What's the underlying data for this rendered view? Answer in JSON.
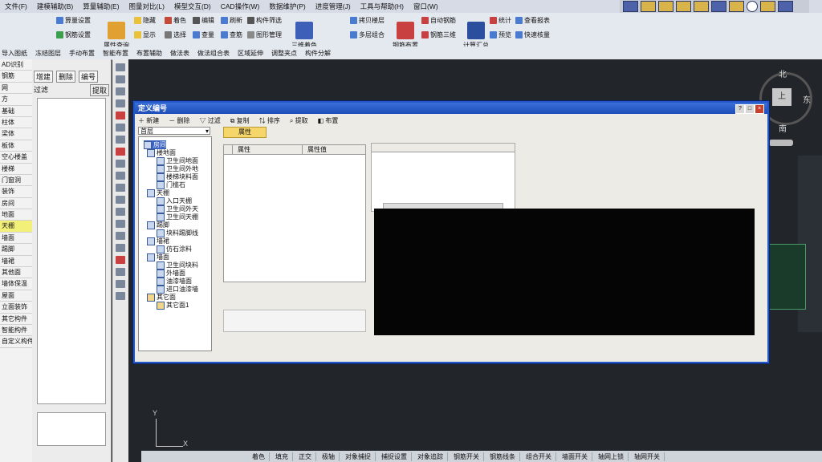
{
  "menu": [
    "文件(F)",
    "建模辅助(B)",
    "算量辅助(E)",
    "图量对比(L)",
    "模型交互(D)",
    "CAD操作(W)",
    "数据维护(P)",
    "进度管理(J)",
    "工具与帮助(H)",
    "窗口(W)"
  ],
  "toolbar": {
    "row1": [
      "算量设置",
      "钢筋设置",
      "隐藏",
      "着色",
      "编辑",
      "刷新",
      "构件筛选",
      "拷贝楼层",
      "自动钢筋",
      "统计",
      "查看报表"
    ],
    "row2": [
      "显示",
      "选择",
      "查量",
      "查筋",
      "图形管理",
      "多层组合",
      "钢筋三维",
      "预览",
      "快速核量"
    ],
    "big": [
      "属性查询",
      "三维着色",
      "钢筋布置",
      "计算汇总"
    ],
    "row3": [
      "导入图纸",
      "冻结图层",
      "手动布置",
      "智能布置",
      "布置辅助",
      "做法表",
      "做法组合表",
      "区域延伸",
      "调整夹点",
      "构件分解"
    ]
  },
  "left_panel": {
    "items": [
      "AD识别",
      "钢筋",
      "网",
      "方",
      "基础",
      "柱体",
      "梁体",
      "板体",
      "空心楼盖",
      "楼梯",
      "门窗洞",
      "装饰",
      "房间",
      "地面",
      "天棚",
      "墙面",
      "踢脚",
      "墙裙",
      "其他面",
      "墙体保温",
      "屋面",
      "立面装饰",
      "其它构件",
      "智能构件",
      "自定义构件"
    ],
    "selected": "天棚"
  },
  "mid_panel": {
    "buttons": [
      "增建",
      "删除",
      "编号"
    ],
    "filter_label": "过滤",
    "extract_label": "提取"
  },
  "dialog": {
    "title": "定义编号",
    "toolbar": [
      "新建",
      "删除",
      "过滤",
      "复制",
      "排序",
      "提取",
      "布置"
    ],
    "floor_select": "首层",
    "tab": "属性",
    "prop_headers": [
      "属性",
      "属性值"
    ],
    "tree": [
      {
        "label": "房间",
        "level": 0,
        "selected": true
      },
      {
        "label": "楼地面",
        "level": 0
      },
      {
        "label": "卫生间地面",
        "level": 1
      },
      {
        "label": "卫生间外地",
        "level": 1
      },
      {
        "label": "楼梯块料面",
        "level": 1
      },
      {
        "label": "门槛石",
        "level": 1
      },
      {
        "label": "天棚",
        "level": 0
      },
      {
        "label": "入口天棚",
        "level": 1
      },
      {
        "label": "卫生间外天",
        "level": 1
      },
      {
        "label": "卫生间天棚",
        "level": 1
      },
      {
        "label": "踢脚",
        "level": 0
      },
      {
        "label": "块料踢脚线",
        "level": 1
      },
      {
        "label": "墙裙",
        "level": 0
      },
      {
        "label": "仿石涂料",
        "level": 1
      },
      {
        "label": "墙面",
        "level": 0
      },
      {
        "label": "卫生间块料",
        "level": 1
      },
      {
        "label": "外墙面",
        "level": 1
      },
      {
        "label": "油漆墙面",
        "level": 1
      },
      {
        "label": "进口油漆墙",
        "level": 1
      },
      {
        "label": "其它面",
        "level": 0
      },
      {
        "label": "其它面1",
        "level": 1
      }
    ]
  },
  "compass": {
    "north": "北",
    "east": "东",
    "south": "南",
    "center": "上"
  },
  "axis": {
    "x": "X",
    "y": "Y"
  },
  "statusbar": [
    "着色",
    "填充",
    "正交",
    "极轴",
    "对象捕捉",
    "捕捉设置",
    "对象追踪",
    "钢筋开关",
    "钢筋线条",
    "组合开关",
    "墙面开关",
    "轴网上锁",
    "轴网开关"
  ],
  "colors": {
    "accent": "#2457c8",
    "selection": "#f3f07a",
    "canvas": "#22262a"
  }
}
